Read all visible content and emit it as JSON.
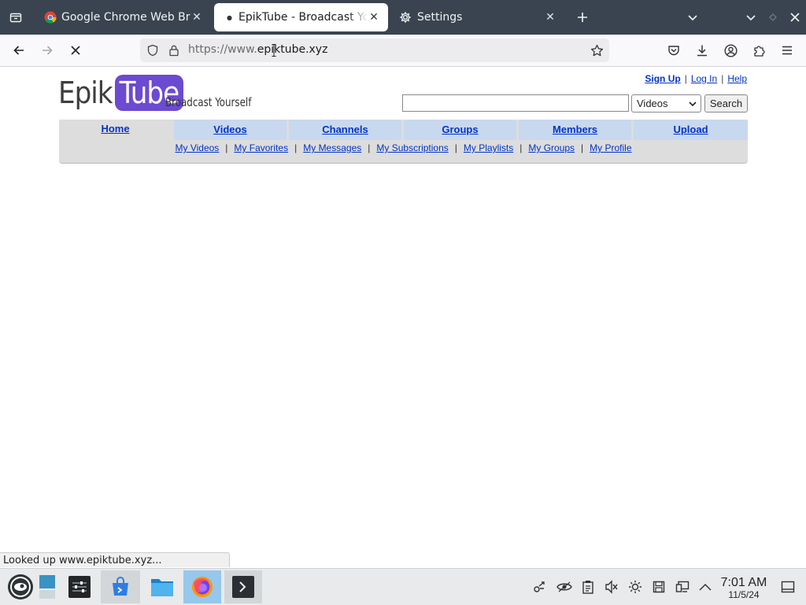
{
  "tabs": [
    {
      "label": "Google Chrome Web Browser"
    },
    {
      "label": "EpikTube - Broadcast Yourself"
    },
    {
      "label": "Settings"
    }
  ],
  "url": {
    "prefix": "https://www.",
    "domain": "epiktube.xyz"
  },
  "site": {
    "logo_left": "Epik",
    "logo_right": "Tube",
    "slogan": "Broadcast Yourself",
    "util_links": [
      "Sign Up",
      "Log In",
      "Help"
    ],
    "search_placeholder": "",
    "search_scope": "Videos",
    "search_button": "Search",
    "main_tabs": [
      "Home",
      "Videos",
      "Channels",
      "Groups",
      "Members",
      "Upload"
    ],
    "sub_links": [
      "My Videos",
      "My Favorites",
      "My Messages",
      "My Subscriptions",
      "My Playlists",
      "My Groups",
      "My Profile"
    ]
  },
  "status_text": "Looked up www.epiktube.xyz...",
  "clock": {
    "time": "7:01 AM",
    "date": "11/5/24"
  },
  "colors": {
    "tab_strip": "#3a4450",
    "logo_purple": "#6c4ad1",
    "tab_blue": "#c8d8ee",
    "link_blue": "#0033cc"
  }
}
